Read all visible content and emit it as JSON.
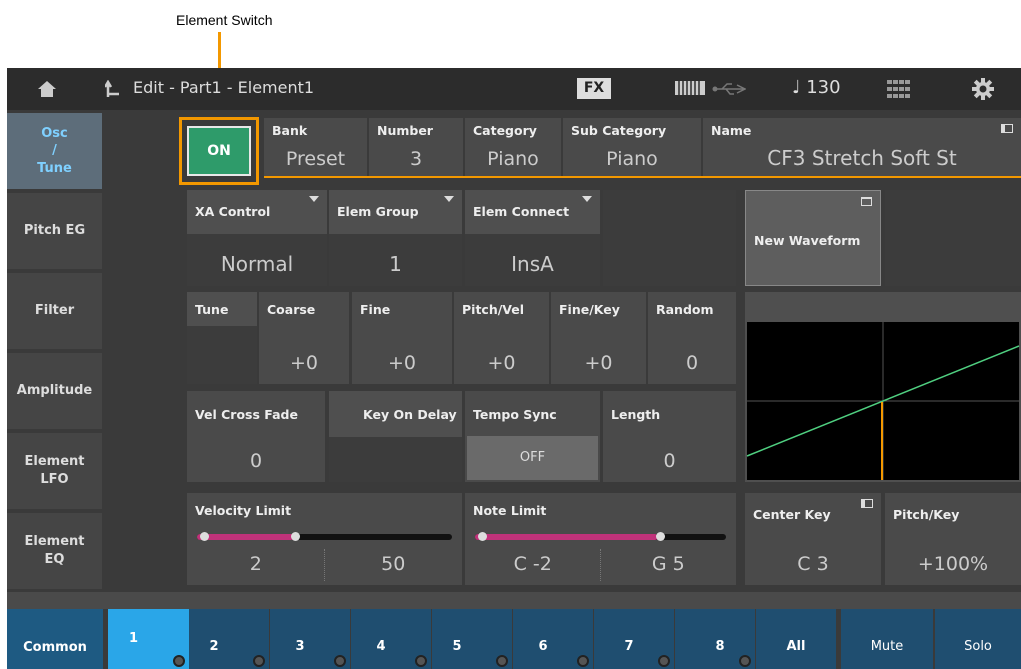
{
  "callout": {
    "label": "Element Switch"
  },
  "titlebar": {
    "title": "Edit - Part1 - Element1",
    "fx": "FX",
    "tempo": "♩ 130",
    "icons": [
      "home-icon",
      "back-arrow-icon",
      "keyboard-icon",
      "usb-icon",
      "grid-icon",
      "gear-icon"
    ]
  },
  "sidebar": {
    "items": [
      {
        "label": "Osc / Tune"
      },
      {
        "label": "Pitch EG"
      },
      {
        "label": "Filter"
      },
      {
        "label": "Amplitude"
      },
      {
        "label": "Element LFO"
      },
      {
        "label": "Element EQ"
      }
    ]
  },
  "row1": {
    "switch": "ON",
    "bank_label": "Bank",
    "bank_value": "Preset",
    "number_label": "Number",
    "number_value": "3",
    "category_label": "Category",
    "category_value": "Piano",
    "subcategory_label": "Sub Category",
    "subcategory_value": "Piano",
    "name_label": "Name",
    "name_value": "CF3 Stretch Soft St"
  },
  "row2": {
    "xa_label": "XA Control",
    "xa_value": "Normal",
    "group_label": "Elem Group",
    "group_value": "1",
    "connect_label": "Elem Connect",
    "connect_value": "InsA",
    "new_waveform": "New Waveform"
  },
  "row3": {
    "tune_label": "Tune",
    "coarse_label": "Coarse",
    "coarse_value": "+0",
    "fine_label": "Fine",
    "fine_value": "+0",
    "pitchvel_label": "Pitch/Vel",
    "pitchvel_value": "+0",
    "finekey_label": "Fine/Key",
    "finekey_value": "+0",
    "random_label": "Random",
    "random_value": "0"
  },
  "row4": {
    "velxfade_label": "Vel Cross Fade",
    "velxfade_value": "0",
    "keyondelay_label": "Key On Delay",
    "temposync_label": "Tempo Sync",
    "temposync_value": "OFF",
    "length_label": "Length",
    "length_value": "0"
  },
  "row5": {
    "vellimit_label": "Velocity Limit",
    "vellimit_low": "2",
    "vellimit_high": "50",
    "notelimit_label": "Note Limit",
    "notelimit_low": "C -2",
    "notelimit_high": "G 5",
    "centerkey_label": "Center Key",
    "centerkey_value": "C 3",
    "pitchkey_label": "Pitch/Key",
    "pitchkey_value": "+100%"
  },
  "bottom": {
    "common": "Common",
    "elements": [
      "1",
      "2",
      "3",
      "4",
      "5",
      "6",
      "7",
      "8"
    ],
    "all": "All",
    "mute": "Mute",
    "solo": "Solo"
  },
  "colors": {
    "accent": "#f39800",
    "on": "#2e9b6a",
    "active_text": "#7fd0ff"
  }
}
